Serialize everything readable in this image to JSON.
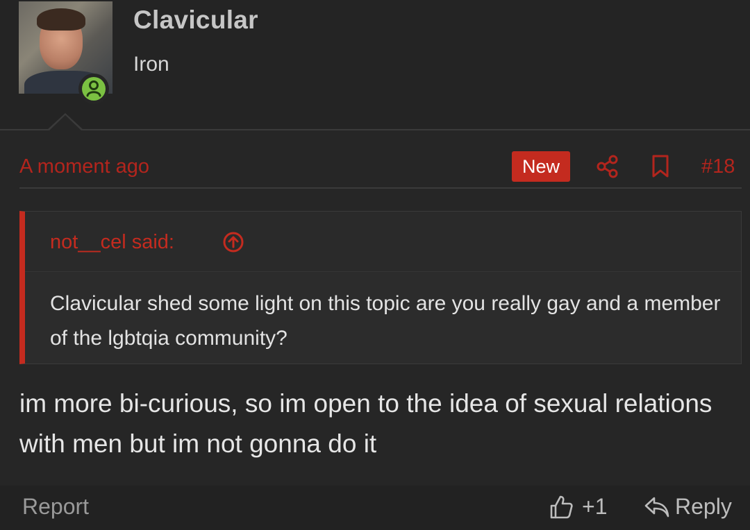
{
  "author": {
    "name": "Clavicular",
    "title": "Iron",
    "avatar_icon": "user-avatar-photo",
    "status_icon": "online-user-icon",
    "status_color": "#7bc142"
  },
  "post_meta": {
    "timestamp": "A moment ago",
    "badge": "New",
    "share_icon": "share-icon",
    "bookmark_icon": "bookmark-icon",
    "post_number": "#18",
    "accent_color": "#c42b1f"
  },
  "quote": {
    "author_label": "not__cel said:",
    "jump_icon": "arrow-up-circle-icon",
    "text": "Clavicular shed some light on this topic are you really gay and a member of the lgbtqia community?"
  },
  "message": {
    "text": "im more bi-curious, so im open to the idea of sexual relations with men but im not gonna do it"
  },
  "actions": {
    "report_label": "Report",
    "like_icon": "thumbs-up-icon",
    "like_count": "+1",
    "reply_icon": "reply-arrow-icon",
    "reply_label": "Reply"
  }
}
